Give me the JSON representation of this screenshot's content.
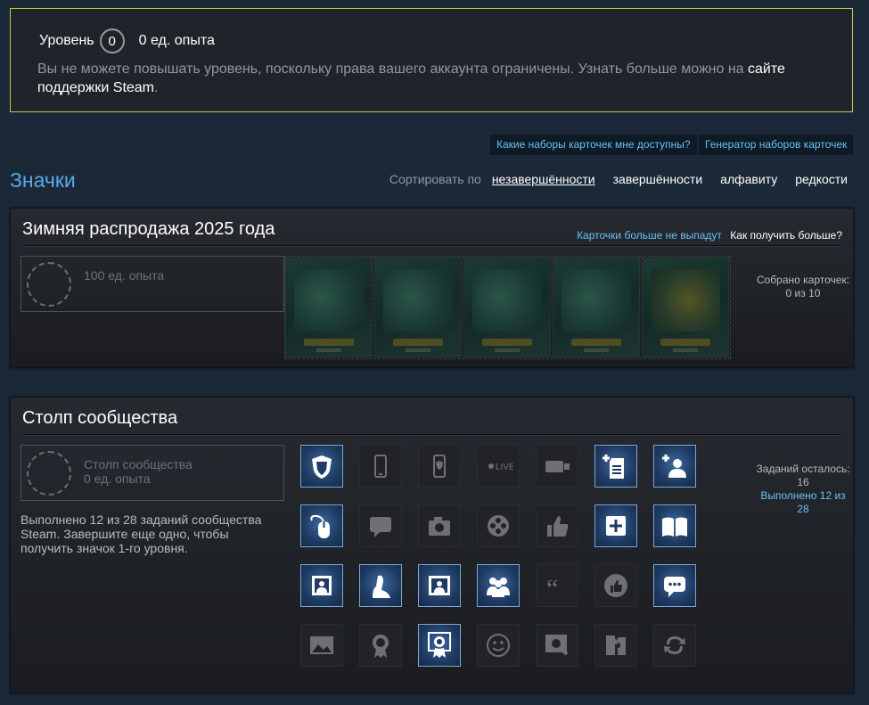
{
  "level_box": {
    "level_label": "Уровень",
    "level_value": "0",
    "xp": "0 ед. опыта",
    "restriction_text": "Вы не можете повышать уровень, поскольку права вашего аккаунта ограничены. Узнать больше можно на ",
    "restriction_link": "сайте поддержки Steam",
    "restriction_end": "."
  },
  "help_buttons": {
    "which_sets": "Какие наборы карточек мне доступны?",
    "generator": "Генератор наборов карточек"
  },
  "page_title": "Значки",
  "sort": {
    "label": "Сортировать по",
    "options": [
      "незавершённости",
      "завершённости",
      "алфавиту",
      "редкости"
    ],
    "active": "незавершённости"
  },
  "winter_badge": {
    "title": "Зимняя распродажа 2025 года",
    "no_drops": "Карточки больше не выпадут",
    "how_more": "Как получить больше?",
    "xp": "100 ед. опыта",
    "cards_collected": "Собрано карточек: 0 из 10",
    "card_count": 5
  },
  "community_badge": {
    "title": "Столп сообщества",
    "badge_name": "Столп сообщества",
    "xp": "0 ед. опыта",
    "description": "Выполнено 12 из 28 заданий сообщества Steam. Завершите еще одно, чтобы получить значок 1-го уровня.",
    "tasks_left": "Заданий осталось: 16",
    "tasks_done": "Выполнено 12 из 28",
    "tasks": [
      {
        "icon": "shield-icon",
        "done": true
      },
      {
        "icon": "phone-icon",
        "done": false
      },
      {
        "icon": "phone-guard-icon",
        "done": false
      },
      {
        "icon": "live-broadcast-icon",
        "done": false
      },
      {
        "icon": "video-camera-icon",
        "done": false
      },
      {
        "icon": "add-document-icon",
        "done": true
      },
      {
        "icon": "add-friend-icon",
        "done": true
      },
      {
        "icon": "mouse-icon",
        "done": true
      },
      {
        "icon": "chat-bubble-icon",
        "done": false
      },
      {
        "icon": "camera-icon",
        "done": false
      },
      {
        "icon": "film-reel-icon",
        "done": false
      },
      {
        "icon": "thumbs-up-icon",
        "done": false
      },
      {
        "icon": "add-box-icon",
        "done": true
      },
      {
        "icon": "book-icon",
        "done": true
      },
      {
        "icon": "profile-picture-icon",
        "done": true
      },
      {
        "icon": "profile-silhouette-icon",
        "done": true
      },
      {
        "icon": "profile-background-icon",
        "done": true
      },
      {
        "icon": "group-icon",
        "done": true
      },
      {
        "icon": "quote-icon",
        "done": false
      },
      {
        "icon": "rate-thumbs-icon",
        "done": false
      },
      {
        "icon": "message-icon",
        "done": true
      },
      {
        "icon": "screenshot-icon",
        "done": false
      },
      {
        "icon": "award-icon",
        "done": false
      },
      {
        "icon": "featured-badge-icon",
        "done": true
      },
      {
        "icon": "emoticon-icon",
        "done": false
      },
      {
        "icon": "workshop-search-icon",
        "done": false
      },
      {
        "icon": "puzzle-icon",
        "done": false
      },
      {
        "icon": "trade-icon",
        "done": false
      }
    ]
  }
}
